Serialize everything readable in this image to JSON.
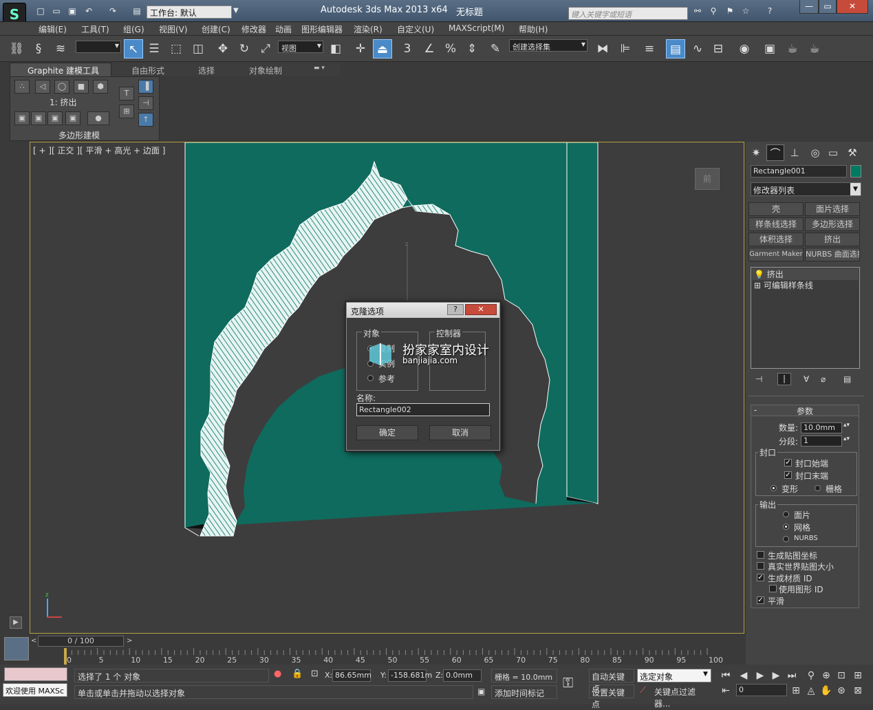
{
  "title_bar": {
    "app_title": "Autodesk 3ds Max  2013 x64",
    "document_title": "无标题",
    "workspace_label": "工作台: 默认",
    "search_placeholder": "键入关键字或短语",
    "min": "—",
    "max": "▭",
    "close": "✕"
  },
  "menu": [
    "编辑(E)",
    "工具(T)",
    "组(G)",
    "视图(V)",
    "创建(C)",
    "修改器",
    "动画",
    "图形编辑器",
    "渲染(R)",
    "自定义(U)",
    "MAXScript(M)",
    "帮助(H)"
  ],
  "main_toolbar": {
    "refcoord": "视图",
    "selection_set": "创建选择集",
    "counter_3": "3"
  },
  "ribbon": {
    "tabs": [
      "Graphite 建模工具",
      "自由形式",
      "选择",
      "对象绘制"
    ],
    "panel_label": "1: 挤出",
    "panel_footer": "多边形建模"
  },
  "viewport": {
    "label": "[ + ][ 正交 ][ 平滑 + 高光 + 边面 ]",
    "viewcube_face": "前",
    "axis_z": "z"
  },
  "command_panel": {
    "object_name": "Rectangle001",
    "object_color": "#007a60",
    "modifier_list": "修改器列表",
    "modifier_buttons": [
      "壳",
      "面片选择",
      "样条线选择",
      "多边形选择",
      "体积选择",
      "挤出",
      "Garment Maker",
      "NURBS 曲面选择"
    ],
    "stack": [
      {
        "label": "挤出",
        "selected": true
      },
      {
        "label": "可编辑样条线",
        "selected": false
      }
    ],
    "params_title": "参数",
    "amount_label": "数量:",
    "amount_value": "10.0mm",
    "segments_label": "分段:",
    "segments_value": "1",
    "cap_group": "封口",
    "cap_start": "封口始端",
    "cap_end": "封口末端",
    "morph": "变形",
    "grid": "栅格",
    "output_group": "输出",
    "patch": "面片",
    "mesh": "网格",
    "nurbs": "NURBS",
    "gen_map": "生成贴图坐标",
    "real_world": "真实世界贴图大小",
    "gen_matid": "生成材质 ID",
    "use_shape_id": "使用图形 ID",
    "smooth": "平滑"
  },
  "clone_dialog": {
    "title": "克隆选项",
    "help": "?",
    "close": "✕",
    "object_group": "对象",
    "controller_group": "控制器",
    "copy": "复制",
    "instance": "实例",
    "reference": "参考",
    "name_label": "名称:",
    "name_value": "Rectangle002",
    "ok": "确定",
    "cancel": "取消"
  },
  "watermark": {
    "line1": "扮家家室内设计",
    "line2": "banjiajia.com"
  },
  "timeline": {
    "slider": "0 / 100",
    "ticks": [
      "0",
      "5",
      "10",
      "15",
      "20",
      "25",
      "30",
      "35",
      "40",
      "45",
      "50",
      "55",
      "60",
      "65",
      "70",
      "75",
      "80",
      "85",
      "90",
      "95",
      "100"
    ]
  },
  "status": {
    "welcome": "欢迎使用  MAXSc",
    "selection": "选择了 1 个 对象",
    "prompt": "单击或单击并拖动以选择对象",
    "x_label": "X:",
    "x": "86.65mm",
    "y_label": "Y:",
    "y": "-158.681m",
    "z_label": "Z:",
    "z": "0.0mm",
    "grid": "栅格 = 10.0mm",
    "add_time_tag": "添加时间标记",
    "auto_key": "自动关键点",
    "set_key": "设置关键点",
    "selected_obj": "选定对象",
    "key_filters": "关键点过滤器...",
    "frame": "0"
  }
}
